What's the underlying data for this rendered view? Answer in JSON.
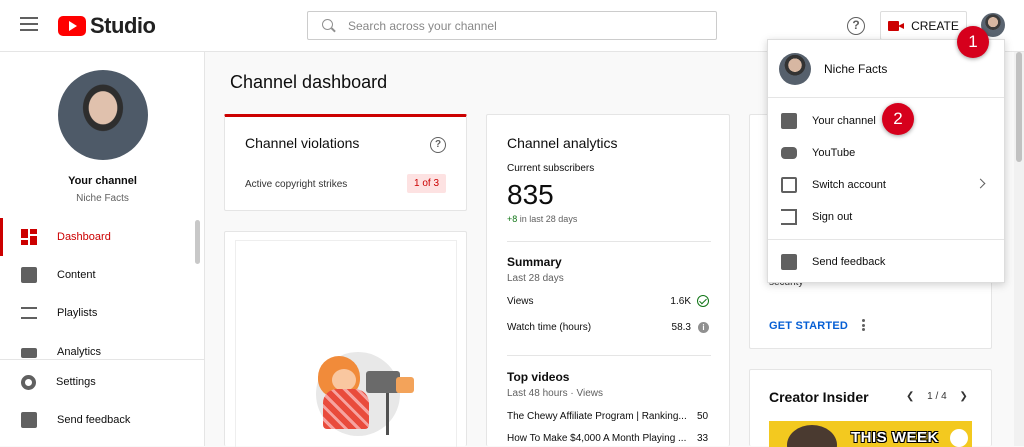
{
  "topbar": {
    "logo_text": "Studio",
    "search_placeholder": "Search across your channel",
    "create_label": "CREATE"
  },
  "annotations": [
    "1",
    "2"
  ],
  "sidebar": {
    "channel_title": "Your channel",
    "channel_name": "Niche Facts",
    "items": [
      {
        "label": "Dashboard",
        "icon": "dashboard-icon",
        "active": true
      },
      {
        "label": "Content",
        "icon": "content-icon"
      },
      {
        "label": "Playlists",
        "icon": "playlists-icon"
      },
      {
        "label": "Analytics",
        "icon": "analytics-icon"
      }
    ],
    "bottom_items": [
      {
        "label": "Settings",
        "icon": "gear-icon"
      },
      {
        "label": "Send feedback",
        "icon": "feedback-icon"
      }
    ]
  },
  "main": {
    "page_title": "Channel dashboard",
    "violations": {
      "title": "Channel violations",
      "strikes_label": "Active copyright strikes",
      "strikes_value": "1 of 3"
    },
    "analytics": {
      "title": "Channel analytics",
      "subscribers_label": "Current subscribers",
      "subscribers_value": "835",
      "gain_value": "+8",
      "gain_period": "in last 28 days",
      "summary_title": "Summary",
      "summary_period": "Last 28 days",
      "views_label": "Views",
      "views_value": "1.6K",
      "watch_label": "Watch time (hours)",
      "watch_value": "58.3",
      "top_videos_title": "Top videos",
      "top_videos_period": "Last 48 hours · Views",
      "videos": [
        {
          "title": "The Chewy Affiliate Program | Ranking...",
          "views": "50"
        },
        {
          "title": "How To Make $4,000 A Month Playing ...",
          "views": "33"
        }
      ]
    },
    "security": {
      "text": "security",
      "cta": "GET STARTED"
    },
    "creator_insider": {
      "title": "Creator Insider",
      "pager": "1 / 4",
      "thumbnail_text": "THIS WEEK"
    }
  },
  "account_menu": {
    "name": "Niche Facts",
    "items": [
      {
        "label": "Your channel",
        "icon": "account-box-icon"
      },
      {
        "label": "YouTube",
        "icon": "youtube-icon"
      },
      {
        "label": "Switch account",
        "icon": "switch-account-icon",
        "has_submenu": true
      },
      {
        "label": "Sign out",
        "icon": "sign-out-icon"
      }
    ],
    "feedback_label": "Send feedback"
  },
  "colors": {
    "brand_red": "#ff0000",
    "accent_red": "#cc0000",
    "badge_red": "#d6001c",
    "link_blue": "#065fd4",
    "positive_green": "#107516"
  }
}
